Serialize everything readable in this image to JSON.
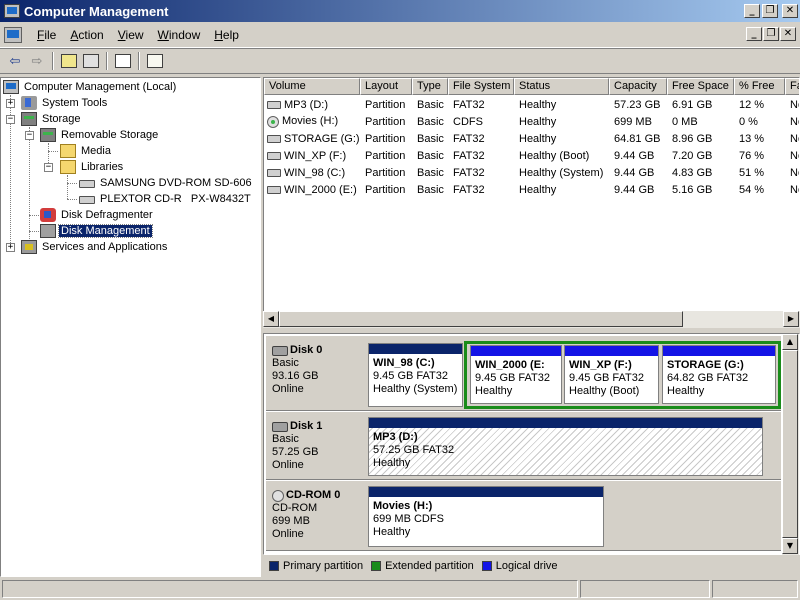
{
  "window": {
    "title": "Computer Management"
  },
  "menu": [
    {
      "underline": "F",
      "rest": "ile"
    },
    {
      "underline": "A",
      "rest": "ction"
    },
    {
      "underline": "V",
      "rest": "iew"
    },
    {
      "underline": "W",
      "rest": "indow"
    },
    {
      "underline": "H",
      "rest": "elp"
    }
  ],
  "toolbar": {
    "icons": [
      "back-arrow-icon",
      "forward-arrow-icon",
      "up-folder-icon",
      "show-hide-tree-icon",
      "properties-icon",
      "help-icon"
    ]
  },
  "tree": {
    "root": "Computer Management (Local)",
    "system_tools": "System Tools",
    "storage": "Storage",
    "removable_storage": "Removable Storage",
    "media": "Media",
    "libraries": "Libraries",
    "samsung": "SAMSUNG DVD-ROM SD-606",
    "plextor": "PLEXTOR CD-R   PX-W8432T",
    "defrag": "Disk Defragmenter",
    "disk_management": "Disk Management",
    "services": "Services and Applications"
  },
  "list": {
    "columns": [
      "Volume",
      "Layout",
      "Type",
      "File System",
      "Status",
      "Capacity",
      "Free Space",
      "% Free",
      "Fa"
    ],
    "rows": [
      {
        "icon": "drive",
        "volume": "MP3 (D:)",
        "layout": "Partition",
        "type": "Basic",
        "fs": "FAT32",
        "status": "Healthy",
        "capacity": "57.23 GB",
        "free": "6.91 GB",
        "pct": "12 %",
        "fa": "No"
      },
      {
        "icon": "cd",
        "volume": "Movies (H:)",
        "layout": "Partition",
        "type": "Basic",
        "fs": "CDFS",
        "status": "Healthy",
        "capacity": "699 MB",
        "free": "0 MB",
        "pct": "0 %",
        "fa": "No"
      },
      {
        "icon": "drive",
        "volume": "STORAGE (G:)",
        "layout": "Partition",
        "type": "Basic",
        "fs": "FAT32",
        "status": "Healthy",
        "capacity": "64.81 GB",
        "free": "8.96 GB",
        "pct": "13 %",
        "fa": "No"
      },
      {
        "icon": "drive",
        "volume": "WIN_XP (F:)",
        "layout": "Partition",
        "type": "Basic",
        "fs": "FAT32",
        "status": "Healthy (Boot)",
        "capacity": "9.44 GB",
        "free": "7.20 GB",
        "pct": "76 %",
        "fa": "No"
      },
      {
        "icon": "drive",
        "volume": "WIN_98 (C:)",
        "layout": "Partition",
        "type": "Basic",
        "fs": "FAT32",
        "status": "Healthy (System)",
        "capacity": "9.44 GB",
        "free": "4.83 GB",
        "pct": "51 %",
        "fa": "No"
      },
      {
        "icon": "drive",
        "volume": "WIN_2000 (E:)",
        "layout": "Partition",
        "type": "Basic",
        "fs": "FAT32",
        "status": "Healthy",
        "capacity": "9.44 GB",
        "free": "5.16 GB",
        "pct": "54 %",
        "fa": "No"
      }
    ]
  },
  "disks": [
    {
      "name": "Disk 0",
      "kind": "Basic",
      "size": "93.16 GB",
      "state": "Online",
      "partitions": [
        {
          "name": "WIN_98  (C:)",
          "size": "9.45 GB FAT32",
          "status": "Healthy (System)"
        },
        {
          "name": "WIN_2000  (E:",
          "size": "9.45 GB FAT32",
          "status": "Healthy"
        },
        {
          "name": "WIN_XP  (F:)",
          "size": "9.45 GB FAT32",
          "status": "Healthy (Boot)"
        },
        {
          "name": "STORAGE  (G:)",
          "size": "64.82 GB FAT32",
          "status": "Healthy"
        }
      ]
    },
    {
      "name": "Disk 1",
      "kind": "Basic",
      "size": "57.25 GB",
      "state": "Online",
      "partitions": [
        {
          "name": "MP3  (D:)",
          "size": "57.25 GB FAT32",
          "status": "Healthy"
        }
      ]
    },
    {
      "name": "CD-ROM 0",
      "kind": "CD-ROM",
      "size": "699 MB",
      "state": "Online",
      "partitions": [
        {
          "name": "Movies  (H:)",
          "size": "699 MB CDFS",
          "status": "Healthy"
        }
      ]
    }
  ],
  "legend": [
    {
      "label": "Primary partition",
      "color": "#0a246a"
    },
    {
      "label": "Extended partition",
      "color": "#1a8c1a"
    },
    {
      "label": "Logical drive",
      "color": "#1414e6"
    }
  ]
}
